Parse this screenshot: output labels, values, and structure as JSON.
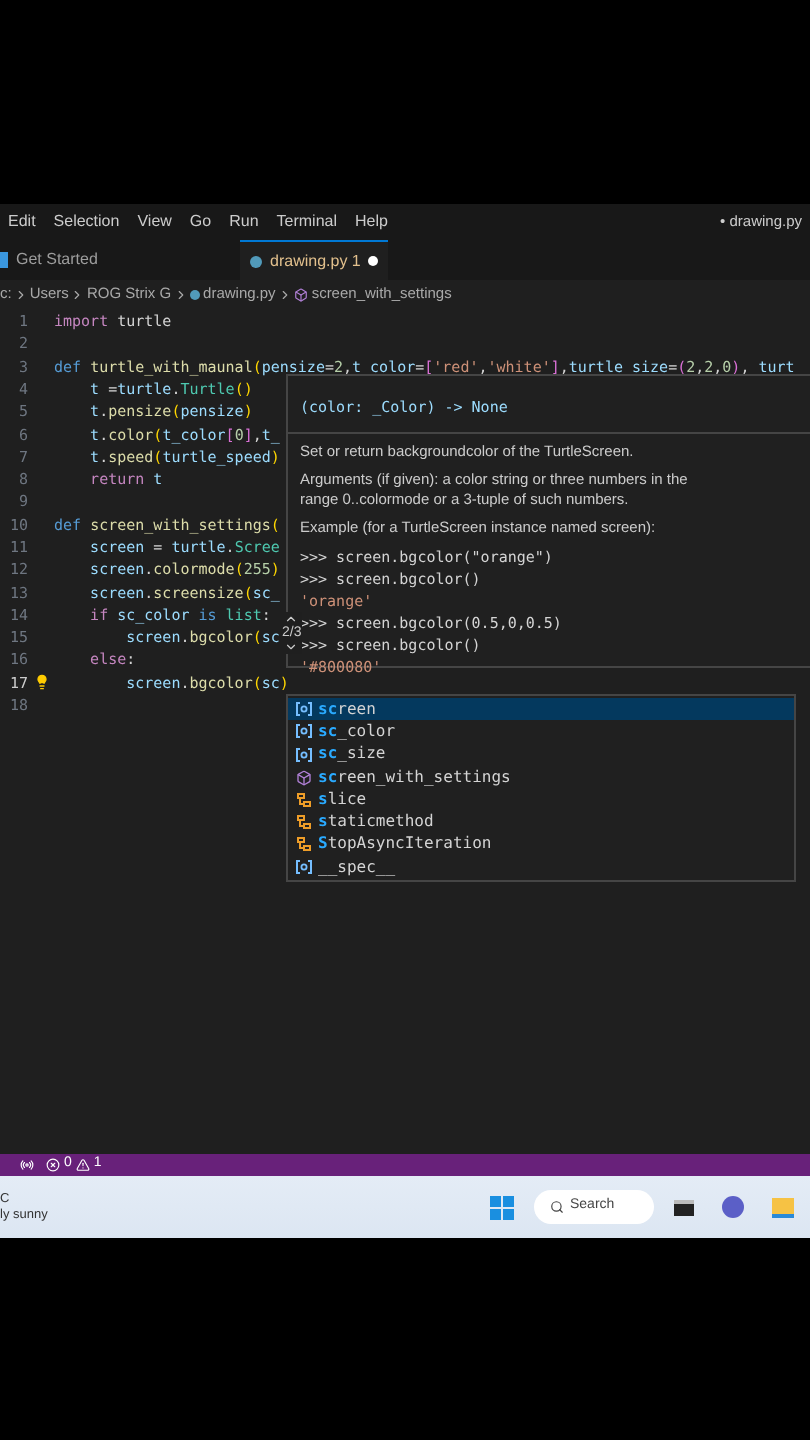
{
  "menu_bar": {
    "items": [
      "Edit",
      "Selection",
      "View",
      "Go",
      "Run",
      "Terminal",
      "Help"
    ],
    "title": "• drawing.py"
  },
  "tabs": [
    {
      "label": "Get Started",
      "selected": false,
      "modified": false
    },
    {
      "label": "drawing.py 1",
      "selected": true,
      "modified": true
    }
  ],
  "breadcrumbs": [
    "c:",
    "Users",
    "ROG Strix G",
    "drawing.py",
    "screen_with_settings"
  ],
  "editor": {
    "lines": [
      {
        "number": "1",
        "current": false,
        "tokens": [
          {
            "text": "import",
            "kind": "ctrl"
          },
          {
            "text": " turtle",
            "kind": "plain"
          }
        ]
      },
      {
        "number": "2",
        "current": false
      },
      {
        "number": "3",
        "current": false,
        "tokens": [
          {
            "text": "def ",
            "kind": "kw"
          },
          {
            "text": "turtle_with_maunal",
            "kind": "fn"
          },
          {
            "text": "(",
            "kind": "b1"
          },
          {
            "text": "pensize",
            "kind": "var"
          },
          {
            "text": "=",
            "kind": "plain"
          },
          {
            "text": "2",
            "kind": "num"
          },
          {
            "text": ",",
            "kind": "plain"
          },
          {
            "text": "t_color",
            "kind": "var"
          },
          {
            "text": "=",
            "kind": "plain"
          },
          {
            "text": "[",
            "kind": "b2"
          },
          {
            "text": "'red'",
            "kind": "str"
          },
          {
            "text": ",",
            "kind": "plain"
          },
          {
            "text": "'white'",
            "kind": "str"
          },
          {
            "text": "]",
            "kind": "b2"
          },
          {
            "text": ",",
            "kind": "plain"
          },
          {
            "text": "turtle_size",
            "kind": "var"
          },
          {
            "text": "=",
            "kind": "plain"
          },
          {
            "text": "(",
            "kind": "b2"
          },
          {
            "text": "2",
            "kind": "num"
          },
          {
            "text": ",",
            "kind": "plain"
          },
          {
            "text": "2",
            "kind": "num"
          },
          {
            "text": ",",
            "kind": "plain"
          },
          {
            "text": "0",
            "kind": "num"
          },
          {
            "text": ")",
            "kind": "b2"
          },
          {
            "text": ", ",
            "kind": "plain"
          },
          {
            "text": "turt",
            "kind": "var"
          }
        ]
      },
      {
        "number": "4",
        "current": false,
        "tokens": [
          {
            "text": "    t",
            "kind": "var"
          },
          {
            "text": " =",
            "kind": "plain"
          },
          {
            "text": "turtle",
            "kind": "var"
          },
          {
            "text": ".",
            "kind": "plain"
          },
          {
            "text": "Turtle",
            "kind": "cls"
          },
          {
            "text": "()",
            "kind": "b1"
          }
        ]
      },
      {
        "number": "5",
        "current": false,
        "tokens": [
          {
            "text": "    t",
            "kind": "var"
          },
          {
            "text": ".",
            "kind": "plain"
          },
          {
            "text": "pensize",
            "kind": "fn"
          },
          {
            "text": "(",
            "kind": "b1"
          },
          {
            "text": "pensize",
            "kind": "var"
          },
          {
            "text": ")",
            "kind": "b1"
          }
        ]
      },
      {
        "number": "6",
        "current": false,
        "tokens": [
          {
            "text": "    t",
            "kind": "var"
          },
          {
            "text": ".",
            "kind": "plain"
          },
          {
            "text": "color",
            "kind": "fn"
          },
          {
            "text": "(",
            "kind": "b1"
          },
          {
            "text": "t_color",
            "kind": "var"
          },
          {
            "text": "[",
            "kind": "b2"
          },
          {
            "text": "0",
            "kind": "num"
          },
          {
            "text": "]",
            "kind": "b2"
          },
          {
            "text": ",",
            "kind": "plain"
          },
          {
            "text": "t_",
            "kind": "var"
          }
        ]
      },
      {
        "number": "7",
        "current": false,
        "tokens": [
          {
            "text": "    t",
            "kind": "var"
          },
          {
            "text": ".",
            "kind": "plain"
          },
          {
            "text": "speed",
            "kind": "fn"
          },
          {
            "text": "(",
            "kind": "b1"
          },
          {
            "text": "turtle_speed",
            "kind": "var"
          },
          {
            "text": ")",
            "kind": "b1"
          }
        ]
      },
      {
        "number": "8",
        "current": false,
        "tokens": [
          {
            "text": "    return",
            "kind": "ctrl"
          },
          {
            "text": " t",
            "kind": "var"
          }
        ]
      },
      {
        "number": "9",
        "current": false
      },
      {
        "number": "10",
        "current": false,
        "tokens": [
          {
            "text": "def ",
            "kind": "kw"
          },
          {
            "text": "screen_with_settings",
            "kind": "fn"
          },
          {
            "text": "(",
            "kind": "b1"
          }
        ]
      },
      {
        "number": "11",
        "current": false,
        "tokens": [
          {
            "text": "    screen",
            "kind": "var"
          },
          {
            "text": " = ",
            "kind": "plain"
          },
          {
            "text": "turtle",
            "kind": "var"
          },
          {
            "text": ".",
            "kind": "plain"
          },
          {
            "text": "Scree",
            "kind": "cls"
          }
        ]
      },
      {
        "number": "12",
        "current": false,
        "tokens": [
          {
            "text": "    screen",
            "kind": "var"
          },
          {
            "text": ".",
            "kind": "plain"
          },
          {
            "text": "colormode",
            "kind": "fn"
          },
          {
            "text": "(",
            "kind": "b1"
          },
          {
            "text": "255",
            "kind": "num"
          },
          {
            "text": ")",
            "kind": "b1"
          }
        ]
      },
      {
        "number": "13",
        "current": false,
        "tokens": [
          {
            "text": "    screen",
            "kind": "var"
          },
          {
            "text": ".",
            "kind": "plain"
          },
          {
            "text": "screensize",
            "kind": "fn"
          },
          {
            "text": "(",
            "kind": "b1"
          },
          {
            "text": "sc_",
            "kind": "var"
          }
        ]
      },
      {
        "number": "14",
        "current": false,
        "tokens": [
          {
            "text": "    if ",
            "kind": "ctrl"
          },
          {
            "text": "sc_color",
            "kind": "var"
          },
          {
            "text": " is ",
            "kind": "kw"
          },
          {
            "text": "list",
            "kind": "cls"
          },
          {
            "text": ":",
            "kind": "plain"
          }
        ]
      },
      {
        "number": "15",
        "current": false,
        "tokens": [
          {
            "text": "        screen",
            "kind": "var"
          },
          {
            "text": ".",
            "kind": "plain"
          },
          {
            "text": "bgcolor",
            "kind": "fn"
          },
          {
            "text": "(",
            "kind": "b1"
          },
          {
            "text": "sc",
            "kind": "var"
          }
        ]
      },
      {
        "number": "16",
        "current": false,
        "tokens": [
          {
            "text": "    else",
            "kind": "ctrl"
          },
          {
            "text": ":",
            "kind": "plain"
          }
        ]
      },
      {
        "number": "17",
        "current": true,
        "tokens": [
          {
            "text": "        screen",
            "kind": "var"
          },
          {
            "text": ".",
            "kind": "plain"
          },
          {
            "text": "bgcolor",
            "kind": "fn"
          },
          {
            "text": "(",
            "kind": "b1"
          },
          {
            "text": "sc",
            "kind": "var"
          },
          {
            "text": ")",
            "kind": "b1"
          }
        ]
      },
      {
        "number": "18",
        "current": false
      }
    ]
  },
  "hover": {
    "signature": "(color: _Color) -> None",
    "paragraphs": [
      "Set or return backgroundcolor of the TurtleScreen.",
      "Arguments (if given): a color string or three numbers in the range 0..colormode or a 3-tuple of such numbers.",
      "Example (for a TurtleScreen instance named screen):"
    ],
    "examples": [
      {
        "text": ">>> screen.bgcolor(\"orange\")",
        "kind": "input"
      },
      {
        "text": ">>> screen.bgcolor()",
        "kind": "input"
      },
      {
        "text": "'orange'",
        "kind": "output"
      },
      {
        "text": ">>> screen.bgcolor(0.5,0,0.5)",
        "kind": "input"
      },
      {
        "text": ">>> screen.bgcolor()",
        "kind": "input"
      },
      {
        "text": "'#800080'",
        "kind": "output"
      }
    ],
    "overload": "2/3"
  },
  "suggestions": [
    {
      "match": "sc",
      "rest": "reen",
      "kind": "variable",
      "selected": true
    },
    {
      "match": "sc",
      "rest": "_color",
      "kind": "variable",
      "selected": false
    },
    {
      "match": "sc",
      "rest": "_size",
      "kind": "variable",
      "selected": false
    },
    {
      "match": "sc",
      "rest": "reen_with_settings",
      "kind": "function",
      "selected": false
    },
    {
      "match": "s",
      "rest": "lice",
      "kind": "class",
      "selected": false
    },
    {
      "match": "s",
      "rest": "taticmethod",
      "kind": "class",
      "selected": false
    },
    {
      "match": "S",
      "rest": "topAsyncIteration",
      "kind": "class",
      "selected": false
    },
    {
      "rest": "__spec__",
      "kind": "variable",
      "selected": false
    }
  ],
  "status_bar": {
    "errors": "0",
    "warnings": "1"
  },
  "taskbar": {
    "weather_temp": "C",
    "weather": "ly sunny",
    "search": "Search"
  }
}
